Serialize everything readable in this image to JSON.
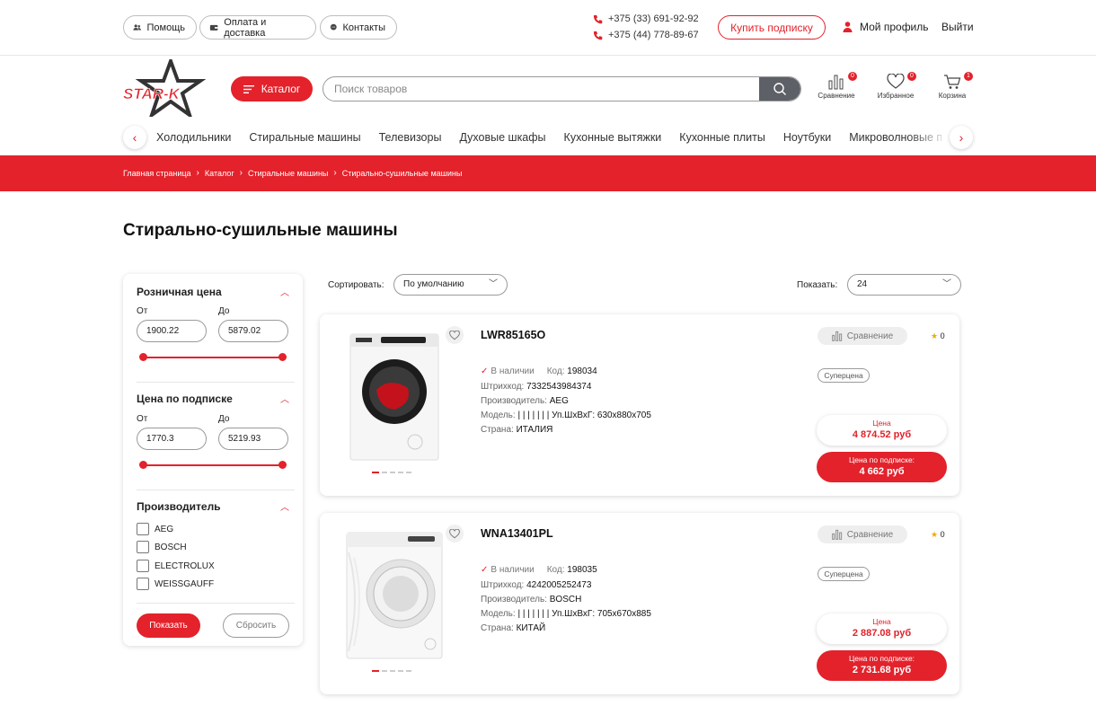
{
  "topbar": {
    "help": "Помощь",
    "payment": "Оплата и доставка",
    "contacts": "Контакты",
    "phones": [
      "+375 (33) 691-92-92",
      "+375 (44) 778-89-67"
    ],
    "subscribe": "Купить подписку",
    "profile": "Мой профиль",
    "logout": "Выйти"
  },
  "header": {
    "logo_text": "STAR-K",
    "catalog": "Каталог",
    "search_placeholder": "Поиск товаров",
    "compare": {
      "label": "Сравнение",
      "count": "0"
    },
    "favorites": {
      "label": "Избранное",
      "count": "0"
    },
    "cart": {
      "label": "Корзина",
      "count": "1"
    }
  },
  "categories": [
    "Холодильники",
    "Стиральные машины",
    "Телевизоры",
    "Духовые шкафы",
    "Кухонные вытяжки",
    "Кухонные плиты",
    "Ноутбуки",
    "Микроволновые печи"
  ],
  "breadcrumb": [
    "Главная страница",
    "Каталог",
    "Стиральные машины",
    "Стирально-сушильные машины"
  ],
  "page_title": "Стирально-сушильные машины",
  "filter": {
    "retail_price": {
      "title": "Розничная цена",
      "from_label": "От",
      "to_label": "До",
      "from": "1900.22",
      "to": "5879.02"
    },
    "sub_price": {
      "title": "Цена по подписке",
      "from_label": "От",
      "to_label": "До",
      "from": "1770.3",
      "to": "5219.93"
    },
    "manufacturer": {
      "title": "Производитель",
      "options": [
        "AEG",
        "BOSCH",
        "ELECTROLUX",
        "WEISSGAUFF"
      ]
    },
    "show": "Показать",
    "reset": "Сбросить"
  },
  "sorting": {
    "sort_label": "Сортировать:",
    "sort_value": "По умолчанию",
    "show_label": "Показать:",
    "show_value": "24"
  },
  "products": [
    {
      "name": "LWR85165O",
      "in_stock": "В наличии",
      "code_label": "Код:",
      "code": "198034",
      "barcode_label": "Штрихкод:",
      "barcode": "7332543984374",
      "maker_label": "Производитель:",
      "maker": "AEG",
      "model_label": "Модель:",
      "model": "| | | | | | | Уп.ШхВхГ: 630х880х705",
      "country_label": "Страна:",
      "country": "ИТАЛИЯ",
      "compare": "Сравнение",
      "rating": "0",
      "badge": "Суперцена",
      "price_label": "Цена",
      "price": "4 874.52 руб",
      "sub_label": "Цена по подписке:",
      "sub_price": "4 662 руб"
    },
    {
      "name": "WNA13401PL",
      "in_stock": "В наличии",
      "code_label": "Код:",
      "code": "198035",
      "barcode_label": "Штрихкод:",
      "barcode": "4242005252473",
      "maker_label": "Производитель:",
      "maker": "BOSCH",
      "model_label": "Модель:",
      "model": "| | | | | | | Уп.ШхВхГ: 705х670х885",
      "country_label": "Страна:",
      "country": "КИТАЙ",
      "compare": "Сравнение",
      "rating": "0",
      "badge": "Суперцена",
      "price_label": "Цена",
      "price": "2 887.08 руб",
      "sub_label": "Цена по подписке:",
      "sub_price": "2 731.68 руб"
    }
  ],
  "colors": {
    "accent": "#e3222b",
    "dark_button": "#5d6066"
  }
}
